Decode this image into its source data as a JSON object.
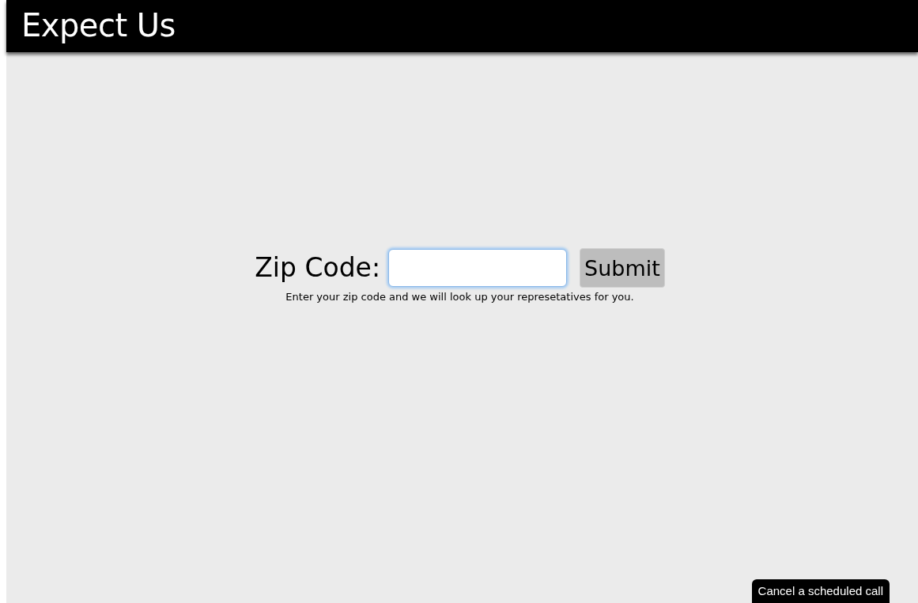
{
  "header": {
    "title": "Expect Us"
  },
  "form": {
    "label": "Zip Code:",
    "field": {
      "focused": true
    },
    "submit": "Submit",
    "hint": "Enter your zip code and we will look up your represetatives for you."
  },
  "footer_tab": {
    "label": "Cancel a scheduled call"
  }
}
